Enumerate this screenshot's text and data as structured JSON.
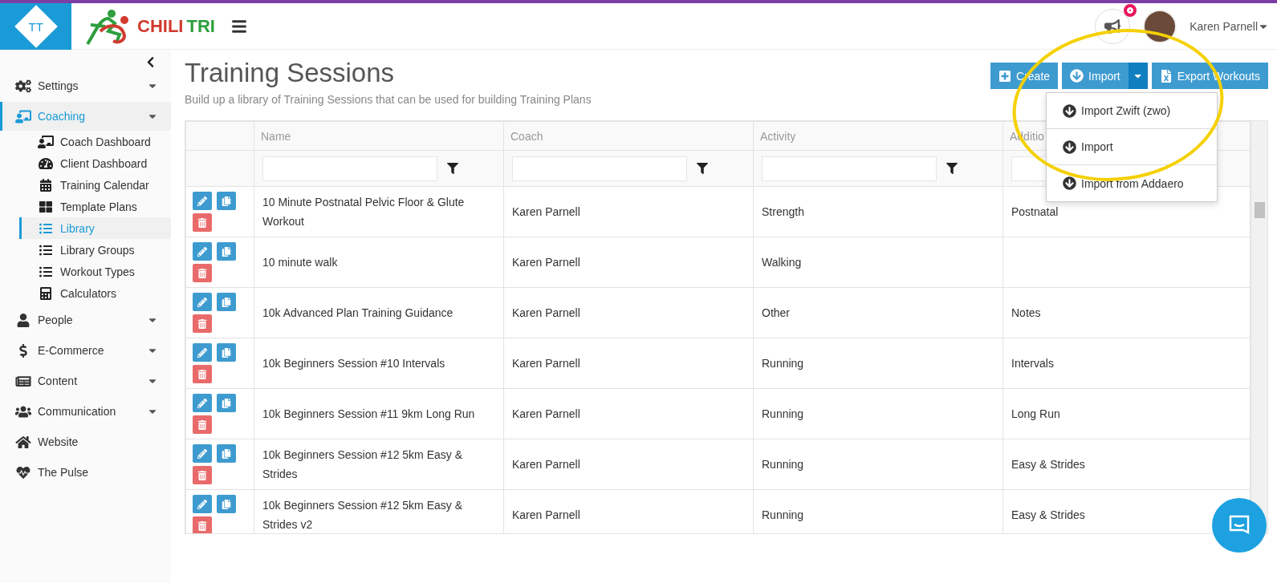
{
  "header": {
    "logo_badge": "TT",
    "brand_first": "CHILI",
    "brand_second": "TRI",
    "notification_dot": true,
    "user": "Karen Parnell"
  },
  "sidebar": {
    "items": [
      {
        "label": "Settings",
        "kind": "menu",
        "selected": false
      },
      {
        "label": "Coaching",
        "kind": "menu",
        "selected": true,
        "expanded": true,
        "children": [
          {
            "label": "Coach Dashboard",
            "selected": false
          },
          {
            "label": "Client Dashboard",
            "selected": false
          },
          {
            "label": "Training Calendar",
            "selected": false
          },
          {
            "label": "Template Plans",
            "selected": false
          },
          {
            "label": "Library",
            "selected": true
          },
          {
            "label": "Library Groups",
            "selected": false
          },
          {
            "label": "Workout Types",
            "selected": false
          },
          {
            "label": "Calculators",
            "selected": false
          }
        ]
      },
      {
        "label": "People",
        "kind": "menu",
        "selected": false
      },
      {
        "label": "E-Commerce",
        "kind": "menu",
        "selected": false
      },
      {
        "label": "Content",
        "kind": "menu",
        "selected": false
      },
      {
        "label": "Communication",
        "kind": "menu",
        "selected": false
      },
      {
        "label": "Website",
        "kind": "link",
        "selected": false
      },
      {
        "label": "The Pulse",
        "kind": "link",
        "selected": false
      }
    ]
  },
  "page": {
    "title": "Training Sessions",
    "subtitle": "Build up a library of Training Sessions that can be used for building Training Plans"
  },
  "actions": [
    {
      "label": "Create",
      "kind": "create"
    },
    {
      "label": "Import",
      "kind": "split"
    },
    {
      "label": "Export Workouts",
      "kind": "export"
    }
  ],
  "import_menu": {
    "open": true,
    "items": [
      "Import Zwift (zwo)",
      "Import",
      "Import from Addaero"
    ]
  },
  "table": {
    "columns": [
      "Name",
      "Coach",
      "Activity",
      "Additio"
    ],
    "rows": [
      {
        "name": "10 Minute Postnatal Pelvic Floor & Glute Workout",
        "coach": "Karen Parnell",
        "activity": "Strength",
        "column_4": "Postnatal"
      },
      {
        "name": "10 minute walk",
        "coach": "Karen Parnell",
        "activity": "Walking"
      },
      {
        "name": "10k Advanced Plan Training Guidance",
        "coach": "Karen Parnell",
        "activity": "Other",
        "column_4": "Notes"
      },
      {
        "name": "10k Beginners Session #10 Intervals",
        "coach": "Karen Parnell",
        "activity": "Running",
        "column_4": "Intervals"
      },
      {
        "name": "10k Beginners Session #11 9km Long Run",
        "coach": "Karen Parnell",
        "activity": "Running",
        "column_4": "Long Run"
      },
      {
        "name": "10k Beginners Session #12 5km Easy & Strides",
        "coach": "Karen Parnell",
        "activity": "Running",
        "column_4": "Easy & Strides"
      },
      {
        "name": "10k Beginners Session #12 5km Easy & Strides v2",
        "coach": "Karen Parnell",
        "activity": "Running",
        "column_4": "Easy & Strides"
      }
    ]
  }
}
